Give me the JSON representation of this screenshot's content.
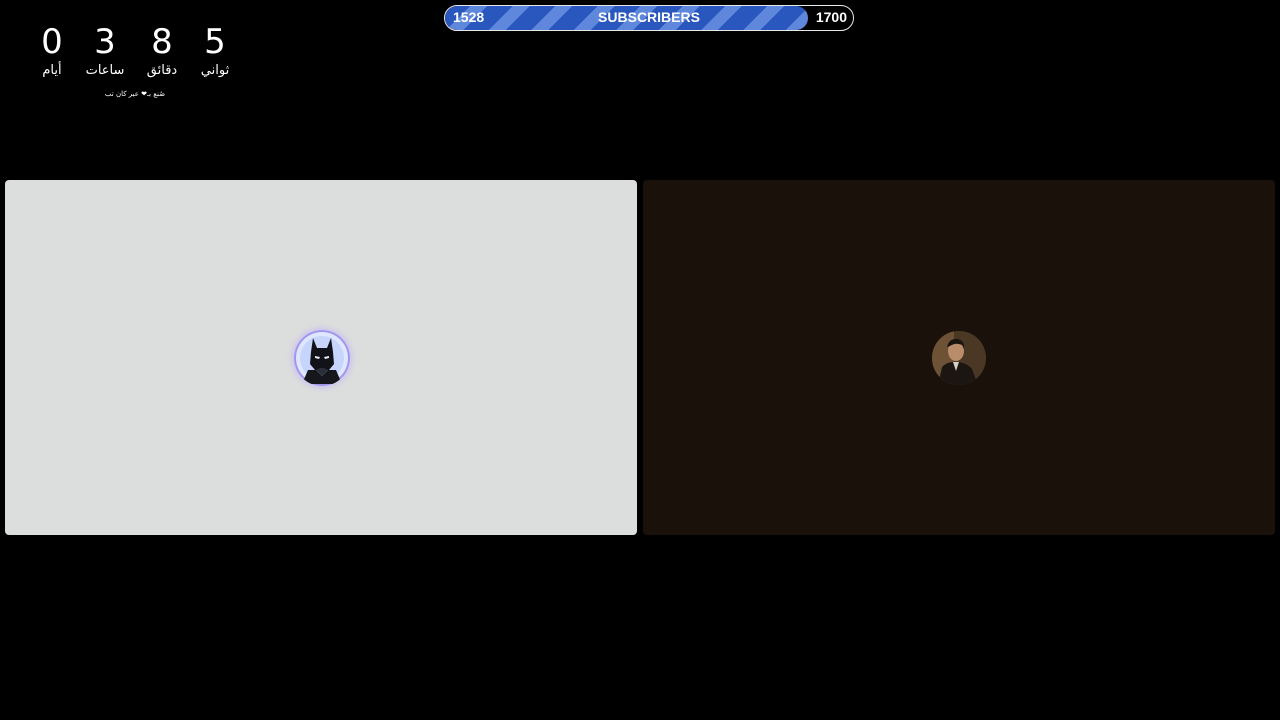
{
  "countdown": {
    "units": [
      {
        "value": "0",
        "label": "أيام"
      },
      {
        "value": "3",
        "label": "ساعات"
      },
      {
        "value": "8",
        "label": "دقائق"
      },
      {
        "value": "5",
        "label": "ثواني"
      }
    ],
    "credit": "صُنع بـ❤ عبر كان تب"
  },
  "subscribers": {
    "start": "1528",
    "title": "SUBSCRIBERS",
    "goal": "1700",
    "progress_fraction": 0.89,
    "fill_color": "#2f5fc8"
  },
  "tiles": [
    {
      "participant_icon": "masked-hero-avatar-icon",
      "background": "#dcdedd"
    },
    {
      "participant_icon": "person-avatar-icon",
      "background": "#1a110a"
    }
  ]
}
